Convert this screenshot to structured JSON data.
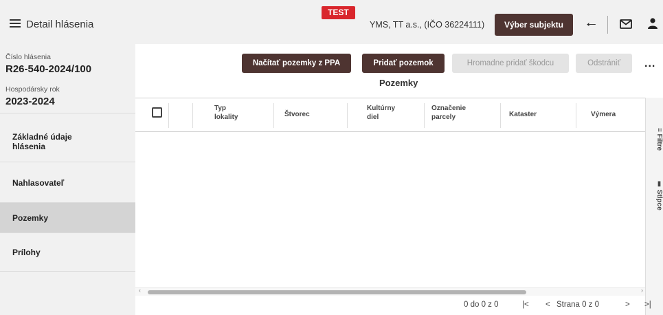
{
  "header": {
    "title": "Detail hlásenia",
    "test_badge": "TEST",
    "subject": "YMS, TT a.s., (IČO 36224111)",
    "select_subject_button": "Výber subjektu"
  },
  "info": {
    "report_number_label": "Číslo hlásenia",
    "report_number": "R26-540-2024/100",
    "year_label": "Hospodársky rok",
    "year": "2023-2024"
  },
  "nav": {
    "items": [
      {
        "label": "Základné údaje hlásenia"
      },
      {
        "label": "Nahlasovateľ"
      },
      {
        "label": "Pozemky"
      },
      {
        "label": "Prílohy"
      }
    ]
  },
  "toolbar": {
    "load_button": "Načítať pozemky z PPA",
    "add_button": "Pridať pozemok",
    "bulk_add_button": "Hromadne pridať škodcu",
    "remove_button": "Odstrániť",
    "more": "..."
  },
  "section": {
    "title": "Pozemky"
  },
  "grid": {
    "columns": [
      {
        "line1": "Typ",
        "line2": "lokality"
      },
      {
        "line1": "Štvorec",
        "line2": ""
      },
      {
        "line1": "Kultúrny",
        "line2": "diel"
      },
      {
        "line1": "Označenie",
        "line2": "parcely"
      },
      {
        "line1": "Kataster",
        "line2": ""
      },
      {
        "line1": "Výmera",
        "line2": ""
      }
    ]
  },
  "side_panel": {
    "filter": "Filtre",
    "columns": "Stĺpce"
  },
  "pager": {
    "summary": "0 do 0 z 0",
    "first": "|<",
    "prev": "<",
    "page": "Strana 0 z 0",
    "next": ">",
    "last": ">|"
  }
}
